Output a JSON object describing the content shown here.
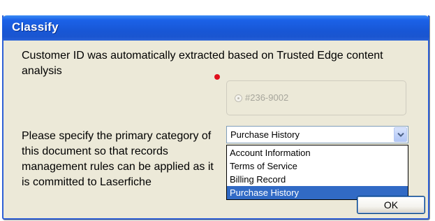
{
  "dialog": {
    "title": "Classify",
    "description": "Customer ID was automatically extracted based on Trusted Edge content analysis",
    "customer_id_option": "#236-9002",
    "prompt": "Please specify the primary category of this document so that records management rules can be applied as it is committed to Laserfiche",
    "category_select": {
      "selected": "Purchase History",
      "options": [
        "Account Information",
        "Terms of Service",
        "Billing Record",
        "Purchase History"
      ],
      "highlighted_index": 3
    },
    "ok_label": "OK"
  },
  "colors": {
    "titlebar": "#1857d6",
    "dialog_bg": "#ece9d8",
    "highlight": "#316ac5",
    "marker": "#e0101c"
  },
  "icons": {
    "dropdown_arrow": "chevron-down-icon",
    "radio": "radio-button-icon"
  }
}
